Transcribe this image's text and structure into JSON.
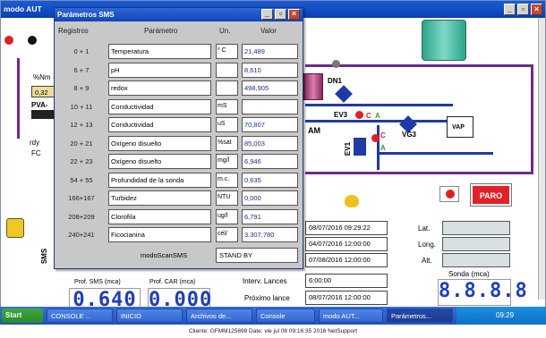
{
  "main_window": {
    "title": "modo AUT"
  },
  "scada": {
    "pct_label": "%Nm",
    "pct_value": "0,32",
    "pva_label": "PVA-",
    "rdy": "rdy",
    "fc": "FC",
    "dn1": "DN1",
    "ev3": "EV3",
    "ev1": "EV1",
    "vg3": "VG3",
    "am": "AM",
    "vap": "VAP",
    "indicator_c": "C",
    "indicator_a": "A",
    "paro": "PARO",
    "sms": "SMS",
    "prof_sms": "Prof. SMS (mca)",
    "prof_car": "Prof. CAR (mca)",
    "display_sms": "0.640",
    "display_car": "0.000",
    "dates": [
      "08/07/2016 09:29:22",
      "04/07/2016 12:00:00",
      "07/08/2016 12:00:00"
    ],
    "lat_label": "Lat.",
    "long_label": "Long.",
    "alt_label": "Alt.",
    "sonda_label": "Sonda (mca)",
    "display_sonda": "8.8.8.8",
    "interv_label": "Interv. Lances",
    "interv_value": "6:00:00",
    "proximo_label": "Próximo lance",
    "proximo_value": "08/07/2016 12:00:00",
    "colors": {
      "pipe_blue": "#1f3aa6",
      "pipe_purple": "#6b2b8f",
      "paro_red": "#e0202a",
      "led_red": "#e02020",
      "led_green": "#2aa02a"
    }
  },
  "dialog": {
    "title": "Parámetros SMS",
    "headers": {
      "registros": "Registros",
      "parametro": "Parámetro",
      "un": "Un.",
      "valor": "Valor"
    },
    "rows": [
      {
        "reg": "0 + 1",
        "param": "Temperatura",
        "unit": "º C",
        "value": "21,489"
      },
      {
        "reg": "6 + 7",
        "param": "pH",
        "unit": "",
        "value": "8,610"
      },
      {
        "reg": "8 + 9",
        "param": "redox",
        "unit": "",
        "value": "498,905"
      },
      {
        "reg": "10 + 11",
        "param": "Conductividad",
        "unit": "mS",
        "value": ""
      },
      {
        "reg": "12 + 13",
        "param": "Conductividad",
        "unit": "uS",
        "value": "70,807"
      },
      {
        "reg": "20 + 21",
        "param": "Oxígeno disuelto",
        "unit": "%sat",
        "value": "85,003"
      },
      {
        "reg": "22 + 23",
        "param": "Oxígeno disuelto",
        "unit": "mg/l",
        "value": "6,946"
      },
      {
        "reg": "54 + 55",
        "param": "Profundidad de la sonda",
        "unit": "m.c.",
        "value": "0,635"
      },
      {
        "reg": "166+167",
        "param": "Turbidez",
        "unit": "NTU",
        "value": "0,000"
      },
      {
        "reg": "208+209",
        "param": "Clorofila",
        "unit": "ug/l",
        "value": "6,791"
      },
      {
        "reg": "240+241",
        "param": "Ficocianina",
        "unit": "cél/",
        "value": "3.307,780"
      }
    ],
    "mode_label": "modoScanSMS",
    "mode_value": "STAND BY"
  },
  "taskbar": {
    "start": "Start",
    "tasks": [
      "CONSOLE ...",
      "INICIO",
      "Archivos de...",
      "Console",
      "modo AUT...",
      "Parámetros..."
    ],
    "clock": "09:29"
  },
  "statusline": "Cliente: GFMM125898   Date: vie jul 08 09:16:35 2016   NetSupport"
}
